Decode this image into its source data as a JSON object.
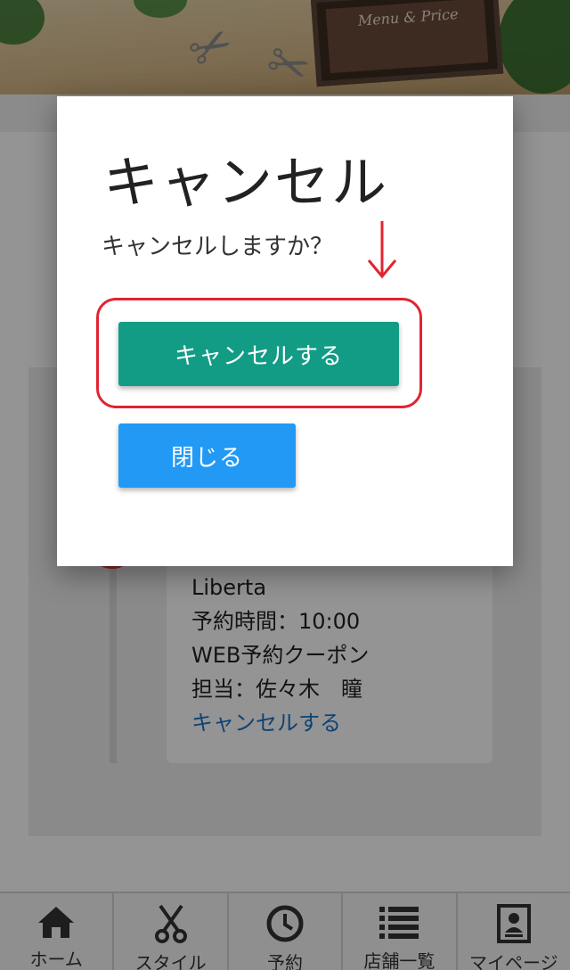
{
  "hero": {
    "sign_text": "Menu & Price"
  },
  "reservation": {
    "salon": "Liberta",
    "time": "予約時間：10:00",
    "coupon": "WEB予約クーポン",
    "staff": "担当：佐々木　瞳",
    "cancel_link": "キャンセルする"
  },
  "modal": {
    "title": "キャンセル",
    "message": "キャンセルしますか？",
    "cancel_button": "キャンセルする",
    "close_button": "閉じる"
  },
  "bottom_nav": {
    "items": [
      {
        "label": "ホーム",
        "icon": "home-icon"
      },
      {
        "label": "スタイル",
        "icon": "scissors-icon"
      },
      {
        "label": "予約",
        "icon": "clock-icon"
      },
      {
        "label": "店舗一覧",
        "icon": "list-icon"
      },
      {
        "label": "マイページ",
        "icon": "profile-card-icon"
      }
    ]
  },
  "colors": {
    "cancel_button": "#129c85",
    "close_button": "#2299f4",
    "annotation_red": "#e02431",
    "link_blue": "#1a73c8"
  }
}
